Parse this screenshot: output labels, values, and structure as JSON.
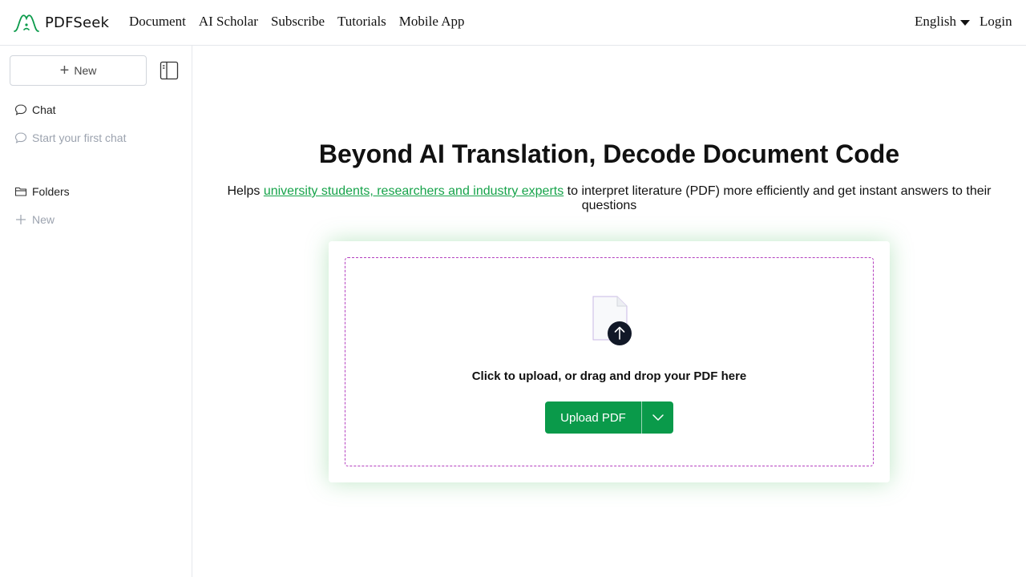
{
  "brand": {
    "name": "PDFSeek",
    "color": "#0a9a4a"
  },
  "nav": {
    "items": [
      {
        "label": "Document"
      },
      {
        "label": "AI Scholar"
      },
      {
        "label": "Subscribe"
      },
      {
        "label": "Tutorials"
      },
      {
        "label": "Mobile App"
      }
    ],
    "language": "English",
    "login": "Login"
  },
  "sidebar": {
    "new_label": "New",
    "chat": {
      "title": "Chat",
      "empty_item": "Start your first chat"
    },
    "folders": {
      "title": "Folders",
      "new_label": "New"
    }
  },
  "hero": {
    "title": "Beyond AI Translation, Decode Document Code",
    "subtitle_prefix": "Helps ",
    "subtitle_link": "university students, researchers and industry experts",
    "subtitle_suffix": " to interpret literature (PDF) more efficiently and get instant answers to their questions"
  },
  "upload": {
    "drop_text": "Click to upload, or drag and drop your PDF here",
    "button_label": "Upload PDF",
    "accent_color": "#0a9a4a",
    "dashed_border_color": "#b43fbf"
  }
}
